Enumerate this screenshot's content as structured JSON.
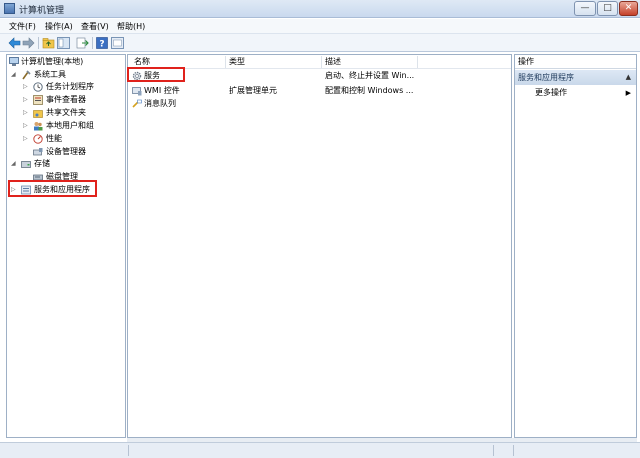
{
  "window": {
    "title": "计算机管理",
    "controls": {
      "minimize": "—",
      "maximize": "□",
      "close": "✕"
    }
  },
  "menu": {
    "items": [
      "文件(F)",
      "操作(A)",
      "查看(V)",
      "帮助(H)"
    ]
  },
  "toolbar": {
    "icons": [
      "back-arrow-icon",
      "forward-arrow-icon",
      "up-folder-icon",
      "show-tree-icon",
      "export-icon",
      "help-icon",
      "properties-icon"
    ]
  },
  "tree": {
    "root": "计算机管理(本地)",
    "system_tools": "系统工具",
    "task_scheduler": "任务计划程序",
    "event_viewer": "事件查看器",
    "shared_folders": "共享文件夹",
    "local_users": "本地用户和组",
    "performance": "性能",
    "device_manager": "设备管理器",
    "storage": "存储",
    "disk_management": "磁盘管理",
    "services_apps": "服务和应用程序"
  },
  "list": {
    "columns": [
      "名称",
      "类型",
      "描述"
    ],
    "rows": [
      {
        "name": "服务",
        "type": "",
        "desc": "启动、终止并设置 Win..."
      },
      {
        "name": "WMI 控件",
        "type": "扩展管理单元",
        "desc": "配置和控制 Windows ..."
      },
      {
        "name": "消息队列",
        "type": "",
        "desc": ""
      }
    ]
  },
  "actions": {
    "title": "操作",
    "section": "服务和应用程序",
    "more": "更多操作",
    "collapse_glyph": "▲",
    "more_glyph": "▶"
  },
  "colors": {
    "highlight": "#e0221c",
    "section_bg": "#dde8f5"
  }
}
